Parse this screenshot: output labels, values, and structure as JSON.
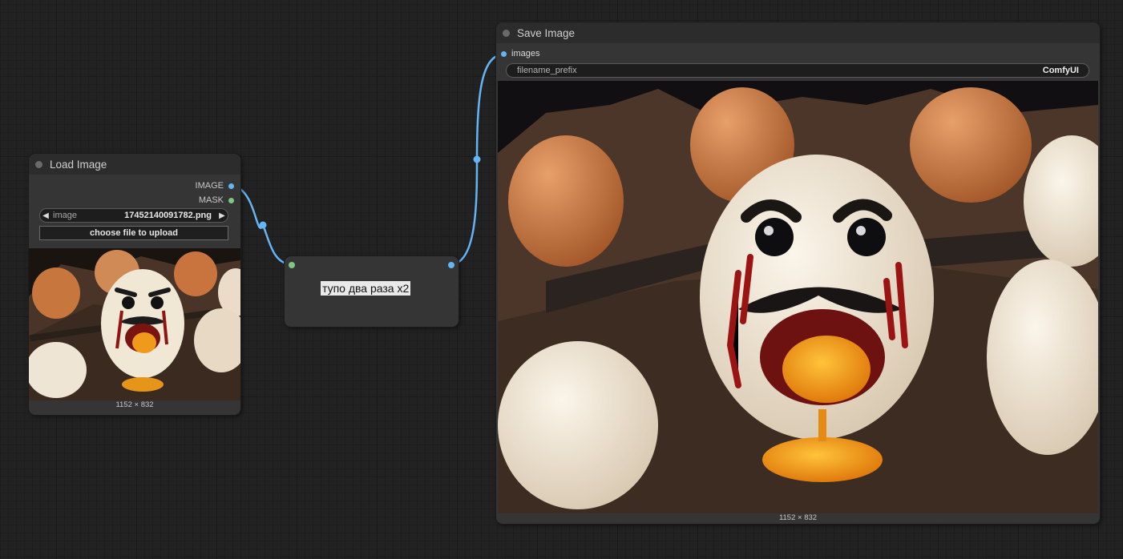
{
  "load_image_node": {
    "title": "Load Image",
    "outputs": [
      {
        "label": "IMAGE",
        "color": "#64b5f6"
      },
      {
        "label": "MASK",
        "color": "#81c784"
      }
    ],
    "image_widget": {
      "label": "image",
      "value": "17452140091782.png"
    },
    "upload_button": "choose file to upload",
    "preview_size": "1152 × 832"
  },
  "note_node": {
    "text": "тупо два раза x2"
  },
  "save_image_node": {
    "title": "Save Image",
    "inputs": [
      {
        "label": "images",
        "color": "#64b5f6"
      }
    ],
    "filename_prefix": {
      "label": "filename_prefix",
      "value": "ComfyUI"
    },
    "preview_size": "1152 × 832"
  },
  "colors": {
    "link_image": "#64b5f6",
    "link_mask": "#81c784",
    "canvas_bg": "#222222",
    "node_bg": "#353535"
  },
  "icons": {
    "arrow_left": "◀",
    "arrow_right": "▶"
  }
}
